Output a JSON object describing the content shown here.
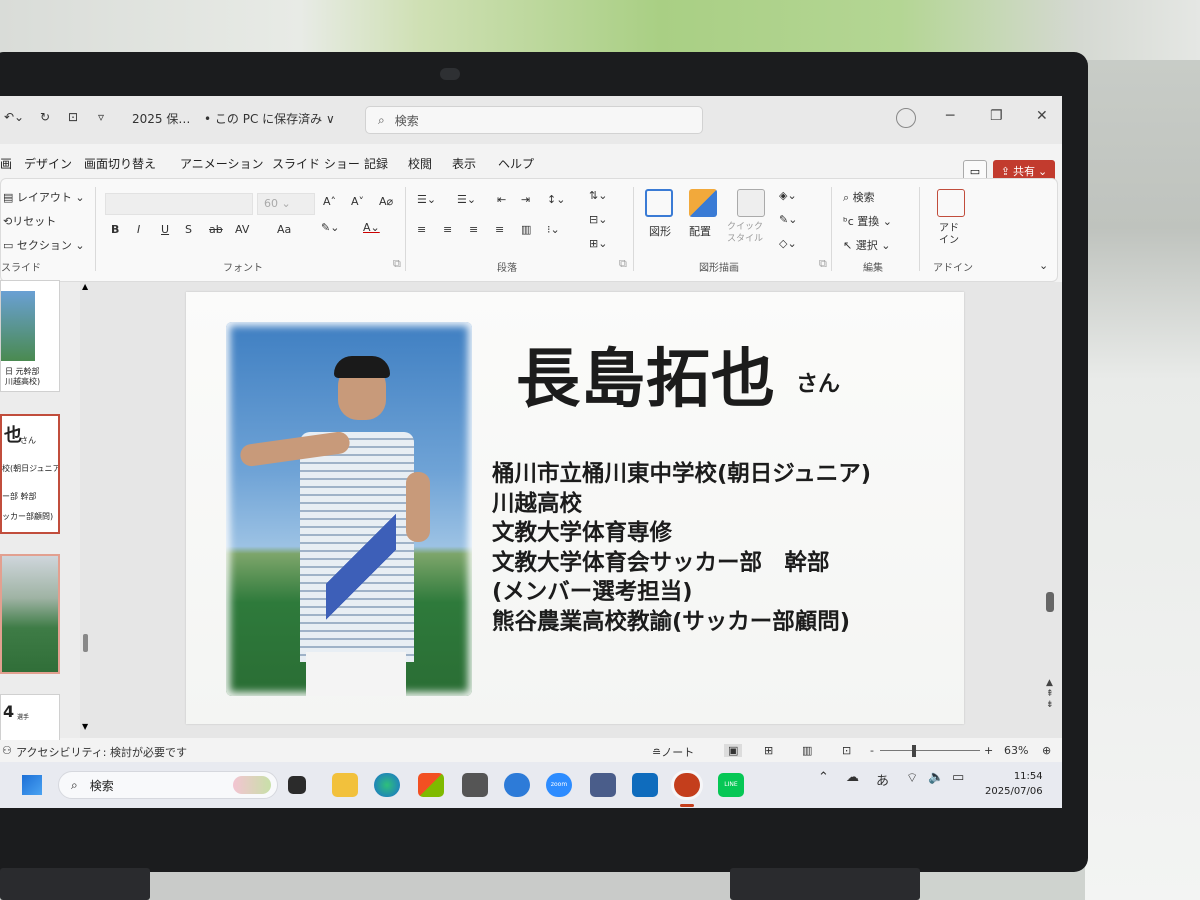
{
  "titlebar": {
    "file_name": "2025 保…",
    "save_status": "• この PC に保存済み ∨",
    "search_placeholder": "検索"
  },
  "menu": {
    "tabs": [
      "画",
      "デザイン",
      "画面切り替え",
      "アニメーション",
      "スライド ショー",
      "記録",
      "校閲",
      "表示",
      "ヘルプ"
    ],
    "share_label": "共有"
  },
  "ribbon": {
    "slides_group": {
      "layout": "レイアウト",
      "reset": "リセット",
      "section": "セクション",
      "label": "スライド"
    },
    "font_group": {
      "size": "60",
      "label": "フォント",
      "bold": "B",
      "italic": "I",
      "underline": "U",
      "strike": "S",
      "strike2": "ab",
      "spacing": "AV",
      "case": "Aa"
    },
    "paragraph_group": {
      "label": "段落"
    },
    "drawing_group": {
      "shapes": "図形",
      "arrange": "配置",
      "quick_style": "クイック\nスタイル",
      "label": "図形描画"
    },
    "editing_group": {
      "find": "検索",
      "replace": "置換",
      "select": "選択",
      "label": "編集"
    },
    "addin_group": {
      "addin": "アド\nイン",
      "label": "アドイン"
    }
  },
  "thumbnails": {
    "t1_line1": "日 元幹部",
    "t1_line2": "川越高校)",
    "t2_title": "也",
    "t2_suffix": "さん",
    "t2_line1": "校(朝日ジュニア)",
    "t2_line2": "ー部 幹部",
    "t2_line3": "ッカー部顧問)",
    "t4_title": "4",
    "t4_suffix": "選手"
  },
  "slide": {
    "name": "長島拓也",
    "name_suffix": "さん",
    "bio": [
      "桶川市立桶川東中学校(朝日ジュニア)",
      "川越高校",
      "文教大学体育専修",
      "文教大学体育会サッカー部　幹部",
      "(メンバー選考担当)",
      "熊谷農業高校教諭(サッカー部顧問)"
    ]
  },
  "statusbar": {
    "accessibility": "アクセシビリティ: 検討が必要です",
    "notes": "ノート",
    "zoom": "63%"
  },
  "taskbar": {
    "search_placeholder": "検索",
    "ime": "あ",
    "time": "11:54",
    "date": "2025/07/06",
    "zoom_app_label": "zoom",
    "line_app_label": "LINE"
  },
  "colors": {
    "accent_red": "#c23b2e",
    "slide_text": "#1c1c1c"
  }
}
